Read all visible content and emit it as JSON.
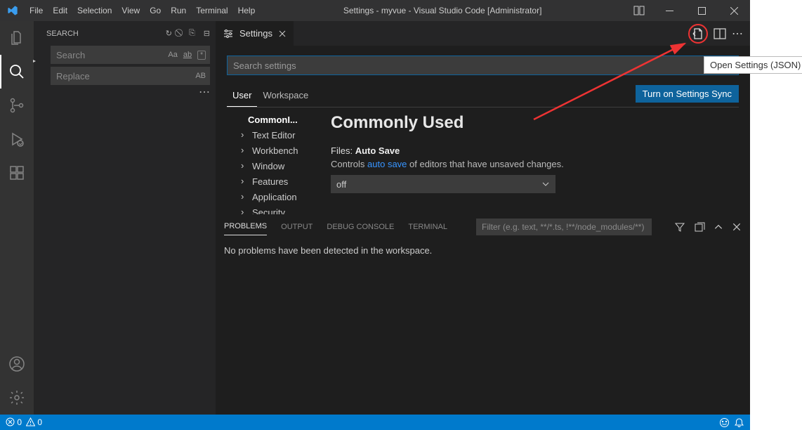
{
  "titlebar": {
    "menus": [
      "File",
      "Edit",
      "Selection",
      "View",
      "Go",
      "Run",
      "Terminal",
      "Help"
    ],
    "title": "Settings - myvue - Visual Studio Code [Administrator]"
  },
  "sidebar": {
    "title": "SEARCH",
    "search_ph": "Search",
    "replace_ph": "Replace",
    "badges": {
      "case": "Aa",
      "word": "ab",
      "regex": "*",
      "preserve": "AB"
    }
  },
  "tab": {
    "label": "Settings"
  },
  "settings": {
    "search_ph": "Search settings",
    "scopes": {
      "user": "User",
      "workspace": "Workspace"
    },
    "sync_btn": "Turn on Settings Sync",
    "tree": [
      "CommonI...",
      "Text Editor",
      "Workbench",
      "Window",
      "Features",
      "Application",
      "Security"
    ],
    "heading": "Commonly Used",
    "item": {
      "scope": "Files:",
      "name": "Auto Save",
      "desc_pre": "Controls ",
      "desc_link": "auto save",
      "desc_post": " of editors that have unsaved changes.",
      "value": "off"
    }
  },
  "panel": {
    "tabs": [
      "PROBLEMS",
      "OUTPUT",
      "DEBUG CONSOLE",
      "TERMINAL"
    ],
    "filter_ph": "Filter (e.g. text, **/*.ts, !**/node_modules/**)",
    "message": "No problems have been detected in the workspace."
  },
  "status": {
    "errors": "0",
    "warnings": "0"
  },
  "tooltip": "Open Settings (JSON)"
}
